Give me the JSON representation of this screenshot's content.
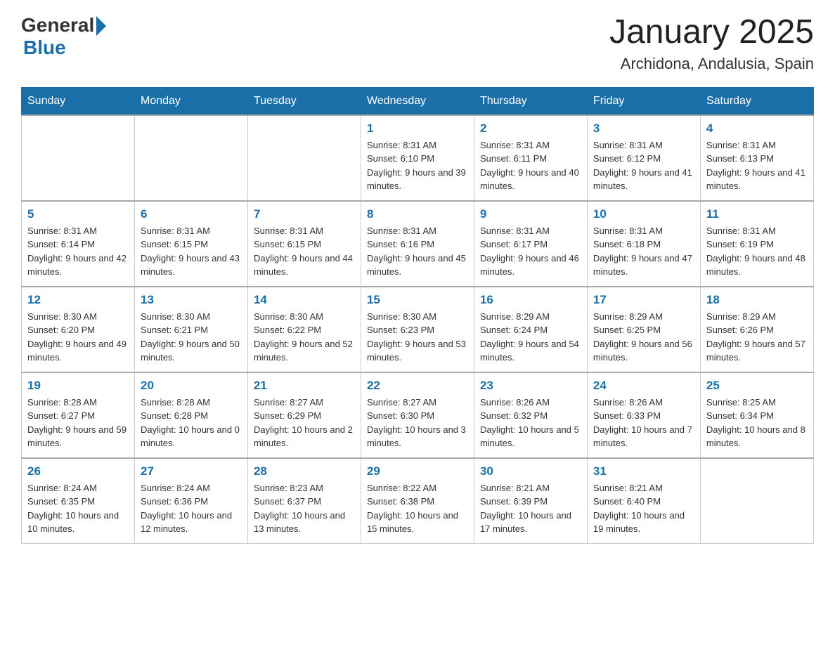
{
  "header": {
    "logo": {
      "general": "General",
      "blue": "Blue"
    },
    "title": "January 2025",
    "location": "Archidona, Andalusia, Spain"
  },
  "days_of_week": [
    "Sunday",
    "Monday",
    "Tuesday",
    "Wednesday",
    "Thursday",
    "Friday",
    "Saturday"
  ],
  "weeks": [
    {
      "days": [
        {
          "number": "",
          "info": ""
        },
        {
          "number": "",
          "info": ""
        },
        {
          "number": "",
          "info": ""
        },
        {
          "number": "1",
          "info": "Sunrise: 8:31 AM\nSunset: 6:10 PM\nDaylight: 9 hours and 39 minutes."
        },
        {
          "number": "2",
          "info": "Sunrise: 8:31 AM\nSunset: 6:11 PM\nDaylight: 9 hours and 40 minutes."
        },
        {
          "number": "3",
          "info": "Sunrise: 8:31 AM\nSunset: 6:12 PM\nDaylight: 9 hours and 41 minutes."
        },
        {
          "number": "4",
          "info": "Sunrise: 8:31 AM\nSunset: 6:13 PM\nDaylight: 9 hours and 41 minutes."
        }
      ]
    },
    {
      "days": [
        {
          "number": "5",
          "info": "Sunrise: 8:31 AM\nSunset: 6:14 PM\nDaylight: 9 hours and 42 minutes."
        },
        {
          "number": "6",
          "info": "Sunrise: 8:31 AM\nSunset: 6:15 PM\nDaylight: 9 hours and 43 minutes."
        },
        {
          "number": "7",
          "info": "Sunrise: 8:31 AM\nSunset: 6:15 PM\nDaylight: 9 hours and 44 minutes."
        },
        {
          "number": "8",
          "info": "Sunrise: 8:31 AM\nSunset: 6:16 PM\nDaylight: 9 hours and 45 minutes."
        },
        {
          "number": "9",
          "info": "Sunrise: 8:31 AM\nSunset: 6:17 PM\nDaylight: 9 hours and 46 minutes."
        },
        {
          "number": "10",
          "info": "Sunrise: 8:31 AM\nSunset: 6:18 PM\nDaylight: 9 hours and 47 minutes."
        },
        {
          "number": "11",
          "info": "Sunrise: 8:31 AM\nSunset: 6:19 PM\nDaylight: 9 hours and 48 minutes."
        }
      ]
    },
    {
      "days": [
        {
          "number": "12",
          "info": "Sunrise: 8:30 AM\nSunset: 6:20 PM\nDaylight: 9 hours and 49 minutes."
        },
        {
          "number": "13",
          "info": "Sunrise: 8:30 AM\nSunset: 6:21 PM\nDaylight: 9 hours and 50 minutes."
        },
        {
          "number": "14",
          "info": "Sunrise: 8:30 AM\nSunset: 6:22 PM\nDaylight: 9 hours and 52 minutes."
        },
        {
          "number": "15",
          "info": "Sunrise: 8:30 AM\nSunset: 6:23 PM\nDaylight: 9 hours and 53 minutes."
        },
        {
          "number": "16",
          "info": "Sunrise: 8:29 AM\nSunset: 6:24 PM\nDaylight: 9 hours and 54 minutes."
        },
        {
          "number": "17",
          "info": "Sunrise: 8:29 AM\nSunset: 6:25 PM\nDaylight: 9 hours and 56 minutes."
        },
        {
          "number": "18",
          "info": "Sunrise: 8:29 AM\nSunset: 6:26 PM\nDaylight: 9 hours and 57 minutes."
        }
      ]
    },
    {
      "days": [
        {
          "number": "19",
          "info": "Sunrise: 8:28 AM\nSunset: 6:27 PM\nDaylight: 9 hours and 59 minutes."
        },
        {
          "number": "20",
          "info": "Sunrise: 8:28 AM\nSunset: 6:28 PM\nDaylight: 10 hours and 0 minutes."
        },
        {
          "number": "21",
          "info": "Sunrise: 8:27 AM\nSunset: 6:29 PM\nDaylight: 10 hours and 2 minutes."
        },
        {
          "number": "22",
          "info": "Sunrise: 8:27 AM\nSunset: 6:30 PM\nDaylight: 10 hours and 3 minutes."
        },
        {
          "number": "23",
          "info": "Sunrise: 8:26 AM\nSunset: 6:32 PM\nDaylight: 10 hours and 5 minutes."
        },
        {
          "number": "24",
          "info": "Sunrise: 8:26 AM\nSunset: 6:33 PM\nDaylight: 10 hours and 7 minutes."
        },
        {
          "number": "25",
          "info": "Sunrise: 8:25 AM\nSunset: 6:34 PM\nDaylight: 10 hours and 8 minutes."
        }
      ]
    },
    {
      "days": [
        {
          "number": "26",
          "info": "Sunrise: 8:24 AM\nSunset: 6:35 PM\nDaylight: 10 hours and 10 minutes."
        },
        {
          "number": "27",
          "info": "Sunrise: 8:24 AM\nSunset: 6:36 PM\nDaylight: 10 hours and 12 minutes."
        },
        {
          "number": "28",
          "info": "Sunrise: 8:23 AM\nSunset: 6:37 PM\nDaylight: 10 hours and 13 minutes."
        },
        {
          "number": "29",
          "info": "Sunrise: 8:22 AM\nSunset: 6:38 PM\nDaylight: 10 hours and 15 minutes."
        },
        {
          "number": "30",
          "info": "Sunrise: 8:21 AM\nSunset: 6:39 PM\nDaylight: 10 hours and 17 minutes."
        },
        {
          "number": "31",
          "info": "Sunrise: 8:21 AM\nSunset: 6:40 PM\nDaylight: 10 hours and 19 minutes."
        },
        {
          "number": "",
          "info": ""
        }
      ]
    }
  ]
}
